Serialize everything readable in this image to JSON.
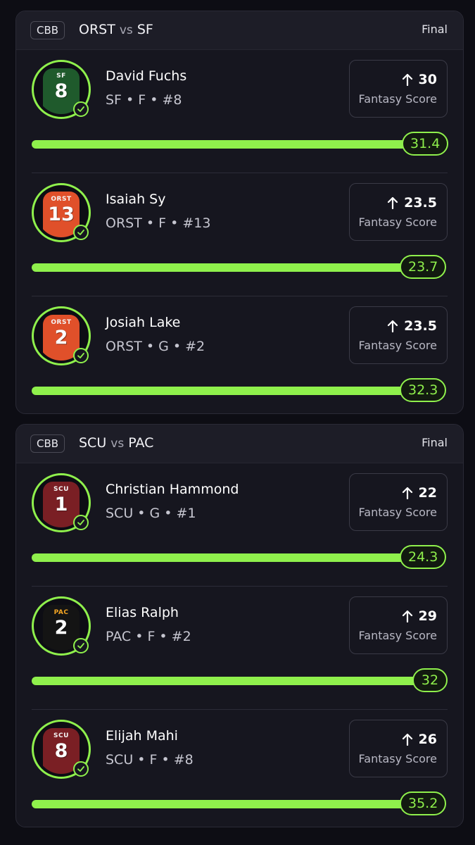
{
  "games": [
    {
      "league": "CBB",
      "team_a": "ORST",
      "vs": "vs",
      "team_b": "SF",
      "status": "Final",
      "players": [
        {
          "name": "David Fuchs",
          "meta": "SF • F • #8",
          "jersey_team": "SF",
          "jersey_number": "8",
          "jersey_color": "#1f5a2c",
          "line": "30",
          "score_label": "Fantasy Score",
          "result": "31.4",
          "progress": 1.0
        },
        {
          "name": "Isaiah Sy",
          "meta": "ORST • F • #13",
          "jersey_team": "ORST",
          "jersey_number": "13",
          "jersey_color": "#e0502a",
          "line": "23.5",
          "score_label": "Fantasy Score",
          "result": "23.7",
          "progress": 1.0
        },
        {
          "name": "Josiah Lake",
          "meta": "ORST • G • #2",
          "jersey_team": "ORST",
          "jersey_number": "2",
          "jersey_color": "#e0502a",
          "line": "23.5",
          "score_label": "Fantasy Score",
          "result": "32.3",
          "progress": 1.0
        }
      ]
    },
    {
      "league": "CBB",
      "team_a": "SCU",
      "vs": "vs",
      "team_b": "PAC",
      "status": "Final",
      "players": [
        {
          "name": "Christian Hammond",
          "meta": "SCU • G • #1",
          "jersey_team": "SCU",
          "jersey_number": "1",
          "jersey_color": "#7a1f24",
          "line": "22",
          "score_label": "Fantasy Score",
          "result": "24.3",
          "progress": 1.0
        },
        {
          "name": "Elias Ralph",
          "meta": "PAC • F • #2",
          "jersey_team": "PAC",
          "jersey_number": "2",
          "jersey_color": "#141414",
          "line": "29",
          "score_label": "Fantasy Score",
          "result": "32",
          "progress": 1.0
        },
        {
          "name": "Elijah Mahi",
          "meta": "SCU • F • #8",
          "jersey_team": "SCU",
          "jersey_number": "8",
          "jersey_color": "#7a1f24",
          "line": "26",
          "score_label": "Fantasy Score",
          "result": "35.2",
          "progress": 1.0
        }
      ]
    }
  ],
  "colors": {
    "accent": "#8ff04c",
    "background": "#0d0d14",
    "card": "#16161f"
  }
}
